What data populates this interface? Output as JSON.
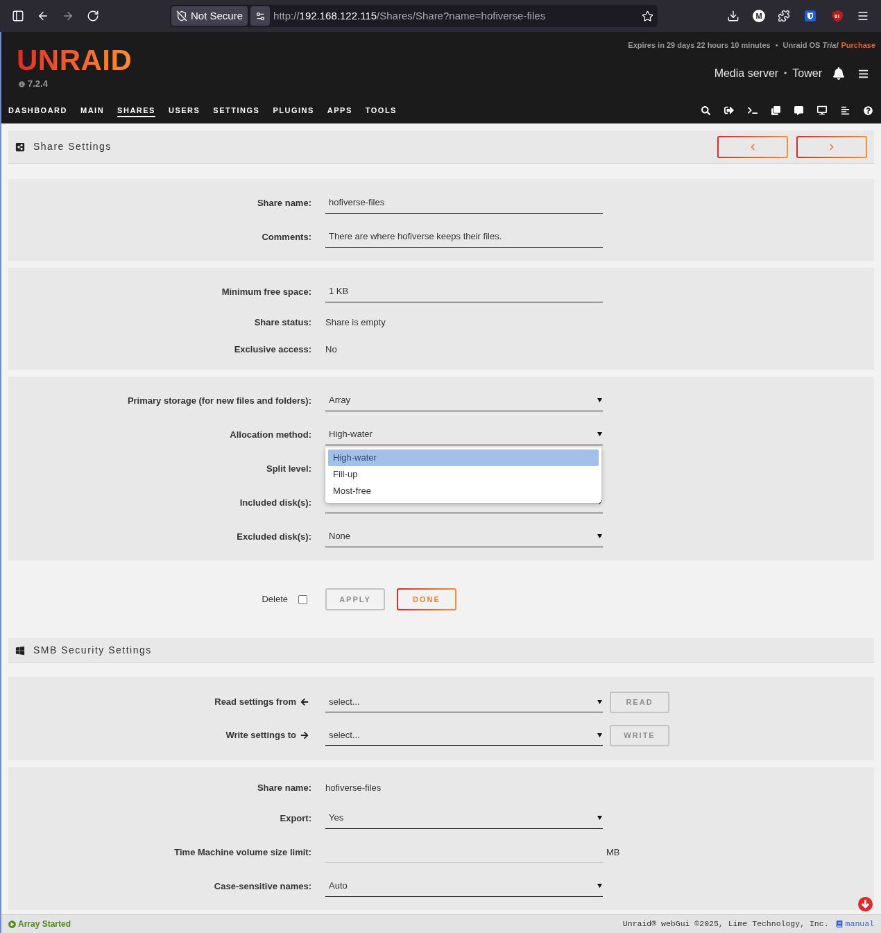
{
  "browser": {
    "security_label": "Not Secure",
    "extension_label": "M",
    "url": {
      "scheme": "http://",
      "host": "192.168.122.115",
      "path": "/Shares/Share?name=hofiverse-files"
    }
  },
  "header": {
    "logo": "UNRAID",
    "version": "7.2.4",
    "expires": "Expires in 29 days 22 hours 10 minutes",
    "separator": "•",
    "license": "Unraid OS *Trial*",
    "purchase": "Purchase",
    "server_description": "Media server",
    "server_separator": "•",
    "server_name": "Tower"
  },
  "nav": [
    {
      "label": "DASHBOARD",
      "selected": false
    },
    {
      "label": "MAIN",
      "selected": false
    },
    {
      "label": "SHARES",
      "selected": true
    },
    {
      "label": "USERS",
      "selected": false
    },
    {
      "label": "SETTINGS",
      "selected": false
    },
    {
      "label": "PLUGINS",
      "selected": false
    },
    {
      "label": "APPS",
      "selected": false
    },
    {
      "label": "TOOLS",
      "selected": false
    }
  ],
  "share_settings": {
    "title": "Share Settings",
    "groups": [
      [
        {
          "kind": "input",
          "label": "Share name:",
          "value": "hofiverse-files",
          "disabled": false
        },
        {
          "kind": "input",
          "label": "Comments:",
          "value": "There are where hofiverse keeps their files.",
          "disabled": false
        }
      ],
      [
        {
          "kind": "input",
          "label": "Minimum free space:",
          "value": "1 KB",
          "disabled": false
        },
        {
          "kind": "text",
          "label": "Share status:",
          "value": "Share is empty"
        },
        {
          "kind": "text",
          "label": "Exclusive access:",
          "value": "No"
        }
      ],
      [
        {
          "kind": "select",
          "label": "Primary storage (for new files and folders):",
          "value": "Array",
          "disabled": false
        },
        {
          "kind": "select",
          "label": "Allocation method:",
          "value": "High-water",
          "disabled": false,
          "expanded": true,
          "options": [
            {
              "label": "High-water",
              "selected": true
            },
            {
              "label": "Fill-up",
              "selected": false
            },
            {
              "label": "Most-free",
              "selected": false
            }
          ]
        },
        {
          "kind": "covered",
          "label": "Split level:"
        },
        {
          "kind": "select",
          "label": "Included disk(s):",
          "disabled": false
        },
        {
          "kind": "select",
          "label": "Excluded disk(s):",
          "value": "None",
          "disabled": false
        }
      ]
    ],
    "delete": {
      "label": "Delete",
      "checked": false
    },
    "buttons": [
      {
        "label": "APPLY",
        "disabled": true
      },
      {
        "label": "DONE",
        "disabled": false
      }
    ]
  },
  "smb_security": {
    "title": "SMB Security Settings",
    "copy_rows": [
      {
        "kind": "read",
        "label": "Read settings from",
        "value": "select...",
        "button": {
          "label": "READ",
          "disabled": true
        }
      },
      {
        "kind": "write",
        "label": "Write settings to",
        "value": "select...",
        "button": {
          "label": "WRITE",
          "disabled": true
        }
      }
    ],
    "rows": [
      {
        "kind": "text",
        "label": "Share name:",
        "value": "hofiverse-files"
      },
      {
        "kind": "select",
        "label": "Export:",
        "value": "Yes",
        "disabled": false
      },
      {
        "kind": "input",
        "label": "Time Machine volume size limit:",
        "unit": "MB",
        "disabled": true
      },
      {
        "kind": "select",
        "label": "Case-sensitive names:",
        "value": "Auto",
        "disabled": false
      }
    ]
  },
  "status_bar": {
    "status": "Array Started",
    "copyright": "Unraid® webGui ©2025, Lime Technology, Inc.",
    "manual": "manual"
  }
}
